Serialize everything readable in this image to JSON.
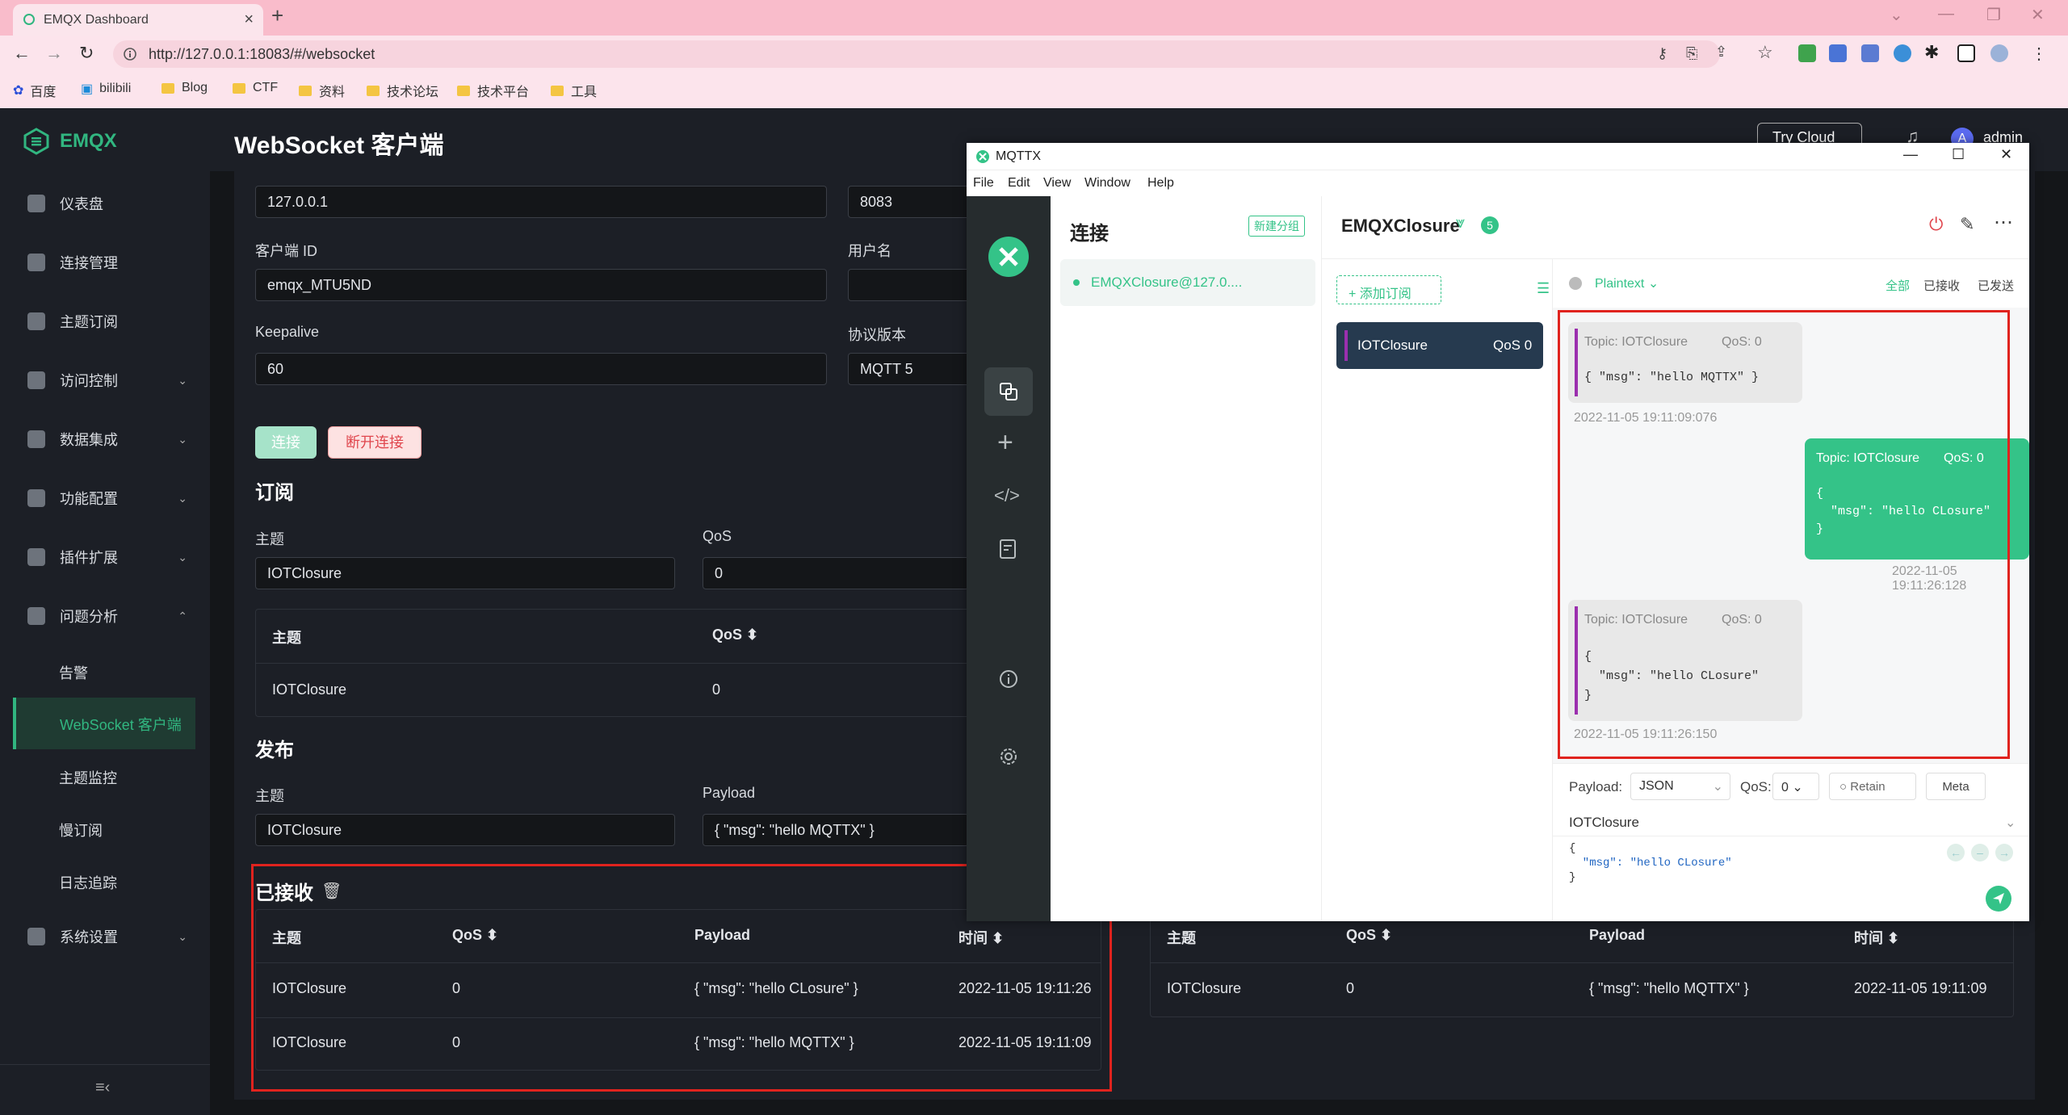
{
  "browser": {
    "tab_title": "EMQX Dashboard",
    "url": "http://127.0.0.1:18083/#/websocket",
    "bookmarks": [
      "百度",
      "bilibili",
      "Blog",
      "CTF",
      "资料",
      "技术论坛",
      "技术平台",
      "工具"
    ]
  },
  "emqx": {
    "logo": "EMQX",
    "page_title": "WebSocket 客户端",
    "try_cloud": "Try Cloud",
    "user": "admin",
    "avatar_letter": "A",
    "sidebar": [
      {
        "label": "仪表盘",
        "icon": "dashboard-icon",
        "chevron": false
      },
      {
        "label": "连接管理",
        "icon": "connections-icon",
        "chevron": false
      },
      {
        "label": "主题订阅",
        "icon": "subscriptions-icon",
        "chevron": false
      },
      {
        "label": "访问控制",
        "icon": "shield-icon",
        "chevron": true
      },
      {
        "label": "数据集成",
        "icon": "integration-icon",
        "chevron": true
      },
      {
        "label": "功能配置",
        "icon": "gear-icon",
        "chevron": true
      },
      {
        "label": "插件扩展",
        "icon": "plugin-icon",
        "chevron": true
      },
      {
        "label": "问题分析",
        "icon": "diagnose-icon",
        "chevron": "up"
      }
    ],
    "sub_items": [
      "告警",
      "WebSocket 客户端",
      "主题监控",
      "慢订阅",
      "日志追踪"
    ],
    "system_settings": "系统设置",
    "collapse_icon": "collapse-icon",
    "host": "127.0.0.1",
    "port": "8083",
    "client_id_label": "客户端 ID",
    "client_id": "emqx_MTU5ND",
    "username_label": "用户名",
    "keepalive_label": "Keepalive",
    "keepalive": "60",
    "protocol_label": "协议版本",
    "protocol": "MQTT 5",
    "connect_btn": "连接",
    "disconnect_btn": "断开连接",
    "subscribe_title": "订阅",
    "topic_label": "主题",
    "qos_label": "QoS",
    "sub_topic": "IOTClosure",
    "sub_qos": "0",
    "sub_table": {
      "headers": [
        "主题",
        "QoS"
      ],
      "rows": [
        [
          "IOTClosure",
          "0"
        ]
      ]
    },
    "publish_title": "发布",
    "payload_label": "Payload",
    "pub_topic": "IOTClosure",
    "pub_payload": "{ \"msg\": \"hello MQTTX\" }",
    "received_title": "已接收",
    "recv_table": {
      "headers": [
        "主题",
        "QoS",
        "Payload",
        "时间"
      ],
      "rows": [
        [
          "IOTClosure",
          "0",
          "{ \"msg\": \"hello CLosure\" }",
          "2022-11-05 19:11:26"
        ],
        [
          "IOTClosure",
          "0",
          "{ \"msg\": \"hello MQTTX\" }",
          "2022-11-05 19:11:09"
        ]
      ]
    },
    "sent_table": {
      "headers": [
        "主题",
        "QoS",
        "Payload",
        "时间"
      ],
      "rows": [
        [
          "IOTClosure",
          "0",
          "{ \"msg\": \"hello MQTTX\" }",
          "2022-11-05 19:11:09"
        ]
      ]
    }
  },
  "mqttx": {
    "title": "MQTTX",
    "menu": [
      "File",
      "Edit",
      "View",
      "Window",
      "Help"
    ],
    "connections_title": "连接",
    "new_group": "新建分组",
    "connection_item": "EMQXClosure@127.0....",
    "conn_name": "EMQXClosure",
    "badge": "5",
    "add_sub": "添加订阅",
    "sub_topic": "IOTClosure",
    "sub_qos": "QoS 0",
    "format": "Plaintext",
    "filters": [
      "全部",
      "已接收",
      "已发送"
    ],
    "messages": [
      {
        "dir": "in",
        "topic": "Topic: IOTClosure",
        "qos": "QoS: 0",
        "lines": [
          "{ \"msg\": \"hello MQTTX\" }"
        ],
        "time": "2022-11-05 19:11:09:076"
      },
      {
        "dir": "out",
        "topic": "Topic: IOTClosure",
        "qos": "QoS: 0",
        "lines": [
          "{",
          "  \"msg\": \"hello CLosure\"",
          "}"
        ],
        "time": "2022-11-05 19:11:26:128"
      },
      {
        "dir": "in",
        "topic": "Topic: IOTClosure",
        "qos": "QoS: 0",
        "lines": [
          "{",
          "  \"msg\": \"hello CLosure\"",
          "}"
        ],
        "time": "2022-11-05 19:11:26:150"
      }
    ],
    "payload_label": "Payload:",
    "payload_format": "JSON",
    "qos_label": "QoS:",
    "qos_value": "0",
    "retain": "Retain",
    "meta": "Meta",
    "pub_topic": "IOTClosure",
    "editor_lines": [
      "{",
      "  \"msg\": \"hello CLosure\"",
      "}"
    ]
  },
  "colors": {
    "accent": "#31b680",
    "highlight_red": "#e0231e",
    "mqttx_green": "#34c388"
  }
}
